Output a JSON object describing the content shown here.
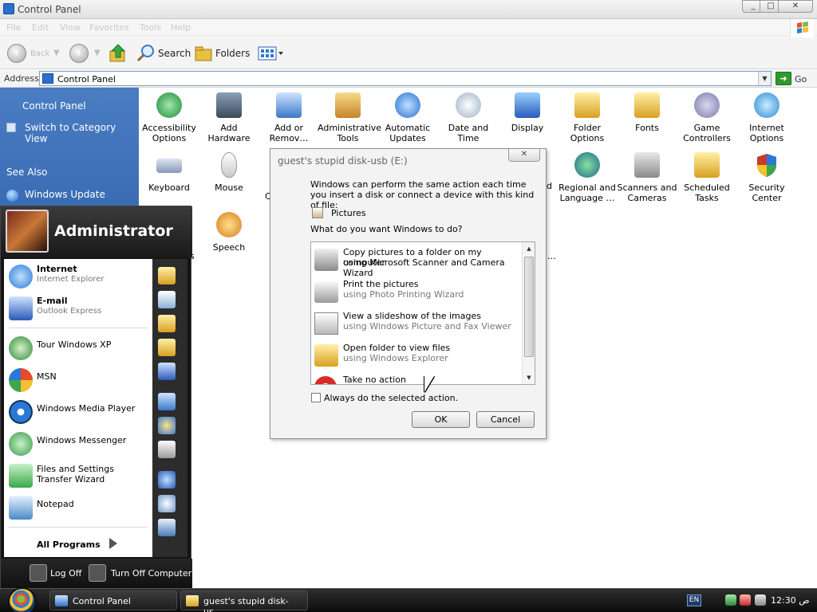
{
  "window": {
    "title": "Control Panel",
    "min": "_",
    "max": "□",
    "close": "✕"
  },
  "menu": [
    "File",
    "Edit",
    "View",
    "Favorites",
    "Tools",
    "Help"
  ],
  "toolbar": {
    "back": "Back",
    "search": "Search",
    "folders": "Folders"
  },
  "address": {
    "label": "Address",
    "value": "Control Panel",
    "go": "Go"
  },
  "leftpanel": {
    "title": "Control Panel",
    "switch": "Switch to Category View",
    "see_also": "See Also",
    "windows_update": "Windows Update"
  },
  "items": [
    {
      "label": "Accessibility Options",
      "color": "#1f8a3c"
    },
    {
      "label": "Add Hardware",
      "color": "#4a5a6a"
    },
    {
      "label": "Add or Remov…",
      "color": "#3a78c8"
    },
    {
      "label": "Administrative Tools",
      "color": "#d8a040"
    },
    {
      "label": "Automatic Updates",
      "color": "#2a6fd0"
    },
    {
      "label": "Date and Time",
      "color": "#b8b8c8"
    },
    {
      "label": "Display",
      "color": "#3a78c8"
    },
    {
      "label": "Folder Options",
      "color": "#e8c040"
    },
    {
      "label": "Fonts",
      "color": "#e8c040"
    },
    {
      "label": "Game Controllers",
      "color": "#8a88b8"
    },
    {
      "label": "Internet Options",
      "color": "#2a8ad0"
    },
    {
      "label": "Keyboard",
      "color": "#8898b8"
    },
    {
      "label": "Mouse",
      "color": "#d8d8d8"
    },
    {
      "label": "Regional and Language …",
      "color": "#2a8a4a"
    },
    {
      "label": "Scanners and Cameras",
      "color": "#a8a8a8"
    },
    {
      "label": "Scheduled Tasks",
      "color": "#e8c040"
    },
    {
      "label": "Security Center",
      "color": "#c83a2a"
    },
    {
      "label": "Speech",
      "color": "#e8a030"
    }
  ],
  "partial_labels": {
    "behind1": "d",
    "behind2": "C",
    "behind3": "s",
    "behind4": "…"
  },
  "startmenu": {
    "user": "Administrator",
    "pinned": [
      {
        "title": "Internet",
        "sub": "Internet Explorer",
        "color": "#2a78d8"
      },
      {
        "title": "E-mail",
        "sub": "Outlook Express",
        "color": "#2a5ab8"
      }
    ],
    "recent": [
      {
        "title": "Tour Windows XP",
        "color": "#2a8a3a"
      },
      {
        "title": "MSN",
        "color": "#e84a2a"
      },
      {
        "title": "Windows Media Player",
        "color": "#2a78d8"
      },
      {
        "title": "Windows Messenger",
        "color": "#3a9a4a"
      },
      {
        "title": "Files and Settings Transfer Wizard",
        "color": "#3aa84a"
      },
      {
        "title": "Notepad",
        "color": "#4a8ac8"
      }
    ],
    "all_programs": "All Programs",
    "logoff": "Log Off",
    "turnoff": "Turn Off Computer"
  },
  "dialog": {
    "title": "guest's stupid disk-usb (E:)",
    "close": "✕",
    "desc": "Windows can perform the same action each time you insert a disk or connect a device with this kind of file:",
    "content_type": "Pictures",
    "question": "What do you want Windows to do?",
    "actions": [
      {
        "a1": "Copy pictures to a folder on my computer",
        "a2": "using Microsoft Scanner and Camera Wizard"
      },
      {
        "a1": "Print the pictures",
        "a2": "using Photo Printing Wizard"
      },
      {
        "a1": "View a slideshow of the images",
        "a2": "using Windows Picture and Fax Viewer"
      },
      {
        "a1": "Open folder to view files",
        "a2": "using Windows Explorer"
      },
      {
        "a1": "Take no action",
        "a2": ""
      }
    ],
    "always": "Always do the selected action.",
    "ok": "OK",
    "cancel": "Cancel"
  },
  "taskbar": {
    "tasks": [
      {
        "label": "Control Panel"
      },
      {
        "label": "guest's stupid disk-us…"
      }
    ],
    "lang": "EN",
    "time": "12:30 ص"
  }
}
